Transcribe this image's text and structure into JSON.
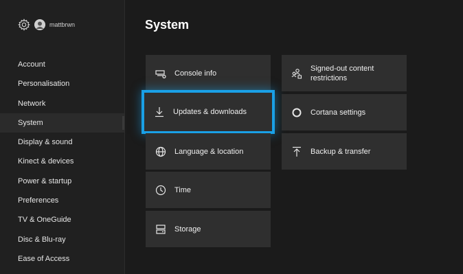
{
  "user": {
    "username": "mattbrwn",
    "settings_icon": "gear-icon",
    "avatar_icon": "avatar"
  },
  "sidebar": {
    "items": [
      {
        "label": "Account"
      },
      {
        "label": "Personalisation"
      },
      {
        "label": "Network"
      },
      {
        "label": "System",
        "selected": true
      },
      {
        "label": "Display & sound"
      },
      {
        "label": "Kinect & devices"
      },
      {
        "label": "Power & startup"
      },
      {
        "label": "Preferences"
      },
      {
        "label": "TV & OneGuide"
      },
      {
        "label": "Disc & Blu-ray"
      },
      {
        "label": "Ease of Access"
      }
    ]
  },
  "page": {
    "title": "System"
  },
  "tiles": {
    "console_info": {
      "label": "Console info",
      "icon": "console-icon"
    },
    "updates_downloads": {
      "label": "Updates & downloads",
      "icon": "download-icon",
      "focused": true
    },
    "language_location": {
      "label": "Language & location",
      "icon": "globe-icon"
    },
    "time": {
      "label": "Time",
      "icon": "clock-icon"
    },
    "storage": {
      "label": "Storage",
      "icon": "storage-icon"
    },
    "signed_out_restrictions": {
      "label": "Signed-out content restrictions",
      "icon": "people-lock-icon"
    },
    "cortana_settings": {
      "label": "Cortana settings",
      "icon": "cortana-icon"
    },
    "backup_transfer": {
      "label": "Backup & transfer",
      "icon": "upload-icon"
    }
  },
  "colors": {
    "background": "#1b1b1b",
    "sidebar": "#202020",
    "tile": "#2f2f2f",
    "focus": "#1aa0e6"
  }
}
